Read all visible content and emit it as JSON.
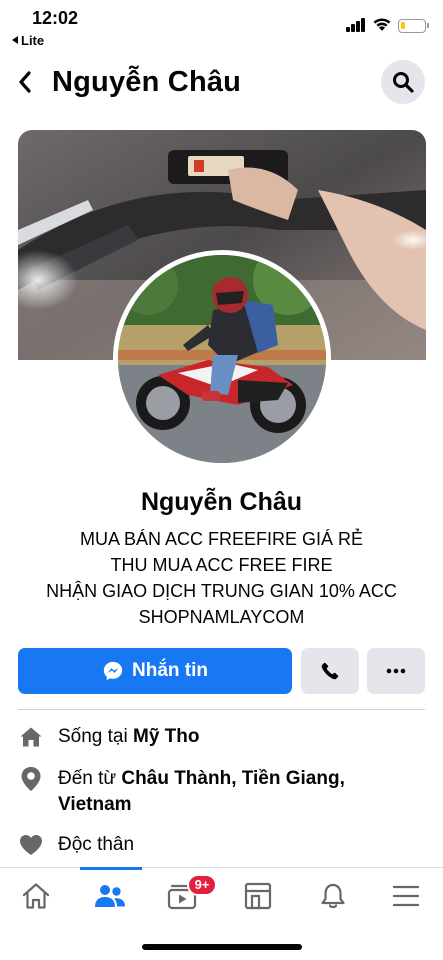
{
  "status_bar": {
    "time": "12:02",
    "back_app_label": "Lite",
    "battery_level": 0.2,
    "battery_color": "#f5c518"
  },
  "header": {
    "title": "Nguyễn Châu",
    "back_icon": "chevron-left-icon",
    "search_icon": "search-icon"
  },
  "profile": {
    "name": "Nguyễn Châu",
    "bio": [
      "MUA BÁN ACC FREEFIRE GIÁ RẺ",
      "THU MUA ACC FREE FIRE",
      "NHẬN GIAO DỊCH TRUNG GIAN 10% ACC",
      "SHOPNAMLAYCOM"
    ]
  },
  "actions": {
    "message_label": "Nhắn tin",
    "message_icon": "messenger-icon",
    "call_icon": "phone-icon",
    "more_icon": "more-icon"
  },
  "details": {
    "lives_prefix": "Sống tại ",
    "lives_place": "Mỹ Tho",
    "from_prefix": "Đến từ ",
    "from_place_line1": "Châu Thành, Tiền Giang,",
    "from_place_line2": "Vietnam",
    "relationship": "Độc thân"
  },
  "bottom_nav": {
    "items": [
      "home-icon",
      "friends-icon",
      "watch-icon",
      "marketplace-icon",
      "notifications-icon",
      "menu-icon"
    ],
    "active": "friends",
    "watch_badge": "9+"
  },
  "colors": {
    "accent": "#1877f2",
    "badge": "#e41e3f",
    "button_gray": "#e4e6eb"
  }
}
